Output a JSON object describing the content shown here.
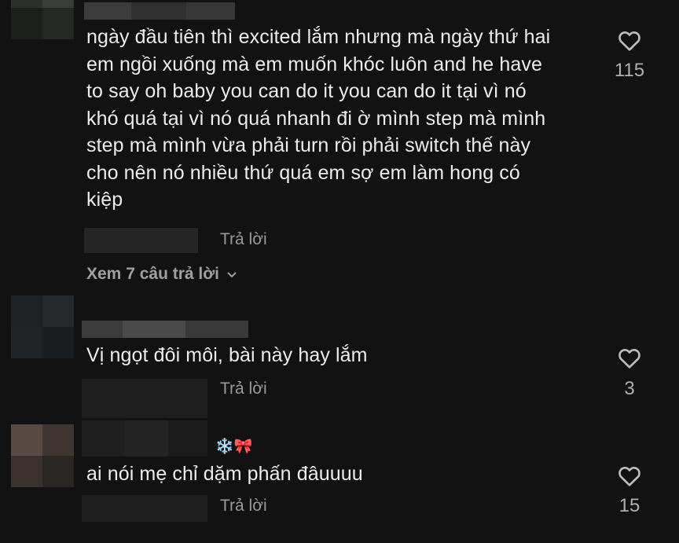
{
  "comments": [
    {
      "text_lines": [
        "ngày đầu tiên thì excited lắm nhưng mà ngày thứ hai",
        "em ngồi xuống mà em muốn khóc luôn and he have",
        "to say oh baby you can do it you can do it tại vì nó",
        "khó quá tại vì nó quá nhanh đi ờ mình step mà mình",
        "step mà mình vừa phải turn rồi phải switch thế này",
        "cho nên nó nhiều thứ quá em sợ em làm hong có",
        "kiệp"
      ],
      "reply_label": "Trả lời",
      "likes": "115",
      "view_replies": "Xem 7 câu trả lời"
    },
    {
      "text": "Vị ngọt đôi môi, bài này hay lắm",
      "reply_label": "Trả lời",
      "likes": "3"
    },
    {
      "text": "ai nói mẹ chỉ dặm phấn đâuuuu",
      "reply_label": "Trả lời",
      "likes": "15",
      "name_emojis": "❄️🎀"
    }
  ],
  "icons": {
    "like": "heart-outline-icon",
    "expand": "chevron-down-icon"
  },
  "colors": {
    "background": "#121212",
    "text": "#ececec",
    "muted": "#9a9a9a"
  }
}
